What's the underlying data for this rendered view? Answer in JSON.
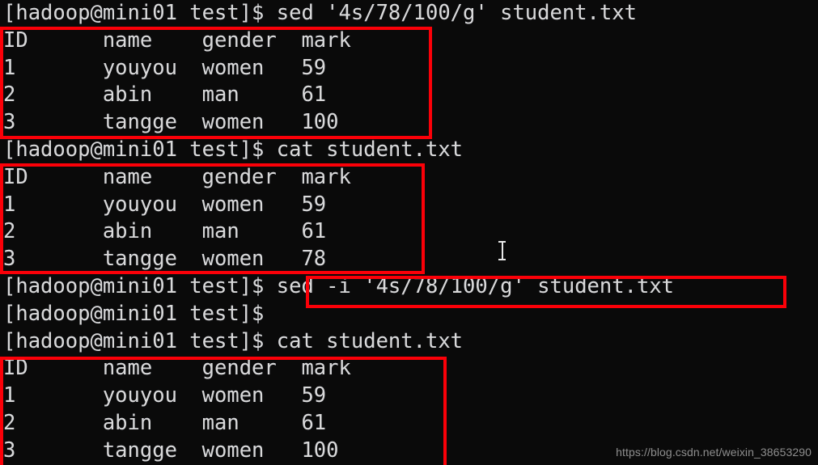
{
  "terminal": {
    "prompt": "[hadoop@mini01 test]$ ",
    "background_color": "#0a0a0a",
    "text_color": "#d9d9d9",
    "annotation_color": "#fb0008",
    "lines": [
      {
        "id": "l0",
        "type": "command",
        "text": "[hadoop@mini01 test]$ sed '4s/78/100/g' student.txt"
      },
      {
        "id": "l1",
        "type": "output",
        "text": "ID      name    gender  mark"
      },
      {
        "id": "l2",
        "type": "output",
        "text": "1       youyou  women   59"
      },
      {
        "id": "l3",
        "type": "output",
        "text": "2       abin    man     61"
      },
      {
        "id": "l4",
        "type": "output",
        "text": "3       tangge  women   100"
      },
      {
        "id": "l5",
        "type": "command",
        "text": "[hadoop@mini01 test]$ cat student.txt"
      },
      {
        "id": "l6",
        "type": "output",
        "text": "ID      name    gender  mark"
      },
      {
        "id": "l7",
        "type": "output",
        "text": "1       youyou  women   59"
      },
      {
        "id": "l8",
        "type": "output",
        "text": "2       abin    man     61"
      },
      {
        "id": "l9",
        "type": "output",
        "text": "3       tangge  women   78"
      },
      {
        "id": "l10",
        "type": "command",
        "text": "[hadoop@mini01 test]$ sed -i '4s/78/100/g' student.txt"
      },
      {
        "id": "l11",
        "type": "command",
        "text": "[hadoop@mini01 test]$"
      },
      {
        "id": "l12",
        "type": "command",
        "text": "[hadoop@mini01 test]$ cat student.txt"
      },
      {
        "id": "l13",
        "type": "output",
        "text": "ID      name    gender  mark"
      },
      {
        "id": "l14",
        "type": "output",
        "text": "1       youyou  women   59"
      },
      {
        "id": "l15",
        "type": "output",
        "text": "2       abin    man     61"
      },
      {
        "id": "l16",
        "type": "output",
        "text": "3       tangge  women   100"
      }
    ],
    "commands": [
      {
        "label": "sed '4s/78/100/g' student.txt"
      },
      {
        "label": "cat student.txt"
      },
      {
        "label": "sed -i '4s/78/100/g' student.txt"
      },
      {
        "label": "cat student.txt"
      }
    ],
    "tables": [
      {
        "name": "sed-preview-output",
        "headers": [
          "ID",
          "name",
          "gender",
          "mark"
        ],
        "rows": [
          [
            "1",
            "youyou",
            "women",
            "59"
          ],
          [
            "2",
            "abin",
            "man",
            "61"
          ],
          [
            "3",
            "tangge",
            "women",
            "100"
          ]
        ]
      },
      {
        "name": "file-before-edit",
        "headers": [
          "ID",
          "name",
          "gender",
          "mark"
        ],
        "rows": [
          [
            "1",
            "youyou",
            "women",
            "59"
          ],
          [
            "2",
            "abin",
            "man",
            "61"
          ],
          [
            "3",
            "tangge",
            "women",
            "78"
          ]
        ]
      },
      {
        "name": "file-after-edit",
        "headers": [
          "ID",
          "name",
          "gender",
          "mark"
        ],
        "rows": [
          [
            "1",
            "youyou",
            "women",
            "59"
          ],
          [
            "2",
            "abin",
            "man",
            "61"
          ],
          [
            "3",
            "tangge",
            "women",
            "100"
          ]
        ]
      }
    ]
  },
  "annotations": [
    {
      "id": "a0",
      "name": "highlight-sed-preview-table"
    },
    {
      "id": "a1",
      "name": "highlight-file-before-edit-table"
    },
    {
      "id": "a2",
      "name": "highlight-sed-inplace-command"
    },
    {
      "id": "a3",
      "name": "highlight-file-after-edit-table"
    }
  ],
  "cursor": {
    "type": "text-ibeam"
  },
  "watermark": {
    "text": "https://blog.csdn.net/weixin_38653290"
  }
}
